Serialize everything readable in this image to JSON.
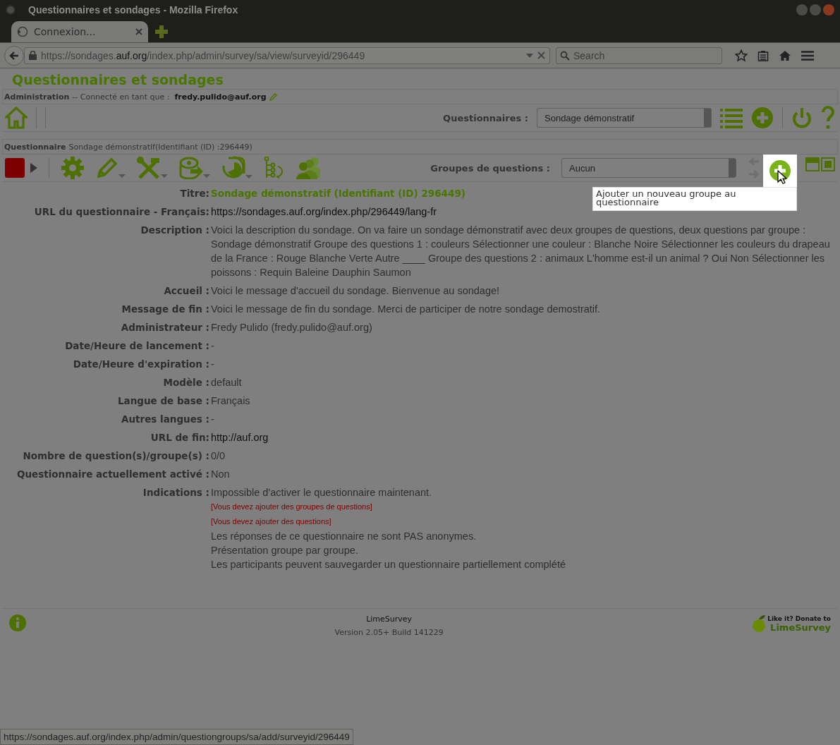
{
  "window": {
    "title": "Questionnaires et sondages - Mozilla Firefox"
  },
  "tabs": [
    {
      "label": "Connexion...",
      "selected": true
    }
  ],
  "address_bar": {
    "prefix": "https://sondages.",
    "host": "auf.org",
    "path": "/index.php/admin/survey/sa/view/surveyid/296449"
  },
  "search": {
    "placeholder": "Search"
  },
  "page": {
    "app_title": "Questionnaires et sondages",
    "admin_bar": {
      "label": "Administration",
      "text": "-- Connecté en tant que :",
      "user": "fredy.pulido@auf.org"
    },
    "survey_bar": {
      "label": "Questionnaires :",
      "value": "Sondage démonstratif"
    },
    "survey_heading": {
      "label": "Questionnaire",
      "text": "Sondage démonstratif(Identifiant (ID) :296449)"
    },
    "group_bar": {
      "label": "Groupes de questions :",
      "value": "Aucun"
    },
    "tooltip": "Ajouter un nouveau groupe au questionnaire",
    "details": [
      {
        "label": "Titre:",
        "kind": "title",
        "lines": [
          {
            "kind": "text",
            "text": "Sondage démonstratif (Identifiant (ID) 296449)"
          }
        ]
      },
      {
        "label": "URL du questionnaire - Français:",
        "kind": "link",
        "lines": [
          {
            "kind": "text",
            "text": "https://sondages.auf.org/index.php/296449/lang-fr"
          }
        ]
      },
      {
        "label": "Description :",
        "kind": "text",
        "lines": [
          {
            "kind": "text",
            "text": "Voici la description du sondage. On va faire un sondage démonstratif avec deux groupes de questions, deux questions par groupe : Sondage démonstratif Groupe des questions 1 : couleurs Sélectionner une couleur : Blanche Noire Sélectionner les couleurs du drapeau de la France : Rouge Blanche Verte Autre ____ Groupe des questions 2 : animaux L'homme est-il un animal ? Oui Non Sélectionner les poissons : Requin Baleine Dauphin Saumon"
          }
        ]
      },
      {
        "label": "Accueil :",
        "kind": "text",
        "lines": [
          {
            "kind": "text",
            "text": "Voici le message d'accueil du sondage. Bienvenue au sondage!"
          }
        ]
      },
      {
        "label": "Message de fin :",
        "kind": "text",
        "lines": [
          {
            "kind": "text",
            "text": "Voici le message de fin du sondage. Merci de participer de notre sondage demostratif."
          }
        ]
      },
      {
        "label": "Administrateur :",
        "kind": "text",
        "lines": [
          {
            "kind": "text",
            "text": "Fredy Pulido (fredy.pulido@auf.org)"
          }
        ]
      },
      {
        "label": "Date/Heure de lancement :",
        "kind": "text",
        "lines": [
          {
            "kind": "text",
            "text": "-"
          }
        ]
      },
      {
        "label": "Date/Heure d'expiration :",
        "kind": "text",
        "lines": [
          {
            "kind": "text",
            "text": "-"
          }
        ]
      },
      {
        "label": "Modèle :",
        "kind": "text",
        "lines": [
          {
            "kind": "text",
            "text": "default"
          }
        ]
      },
      {
        "label": "Langue de base :",
        "kind": "text",
        "lines": [
          {
            "kind": "text",
            "text": "Français"
          }
        ]
      },
      {
        "label": "Autres langues :",
        "kind": "text",
        "lines": [
          {
            "kind": "text",
            "text": "-"
          }
        ]
      },
      {
        "label": "URL de fin:",
        "kind": "link",
        "lines": [
          {
            "kind": "text",
            "text": "http://auf.org"
          }
        ]
      },
      {
        "label": "Nombre de question(s)/groupe(s) :",
        "kind": "text",
        "lines": [
          {
            "kind": "text",
            "text": "0/0"
          }
        ]
      },
      {
        "label": "Questionnaire actuellement activé :",
        "kind": "text",
        "lines": [
          {
            "kind": "text",
            "text": "Non"
          }
        ]
      },
      {
        "label": "Indications :",
        "kind": "text",
        "lines": [
          {
            "kind": "text",
            "text": "Impossible d'activer le questionnaire maintenant."
          },
          {
            "kind": "warning",
            "text": "[Vous devez ajouter des groupes de questions]"
          },
          {
            "kind": "warning",
            "text": "[Vous devez ajouter des questions]"
          },
          {
            "kind": "text",
            "text": "Les réponses de ce questionnaire ne sont PAS anonymes."
          },
          {
            "kind": "text",
            "text": "Présentation groupe par groupe."
          },
          {
            "kind": "text",
            "text": "Les participants peuvent sauvegarder un questionnaire partiellement complété"
          }
        ]
      }
    ],
    "footer": {
      "name": "LimeSurvey",
      "version": "Version 2.05+ Build 141229",
      "donate_text": "Like it? Donate to",
      "donate_brand": "LimeSurvey"
    }
  },
  "status_bar": {
    "url": "https://sondages.auf.org/index.php/admin/questiongroups/sa/add/surveyid/296449"
  }
}
